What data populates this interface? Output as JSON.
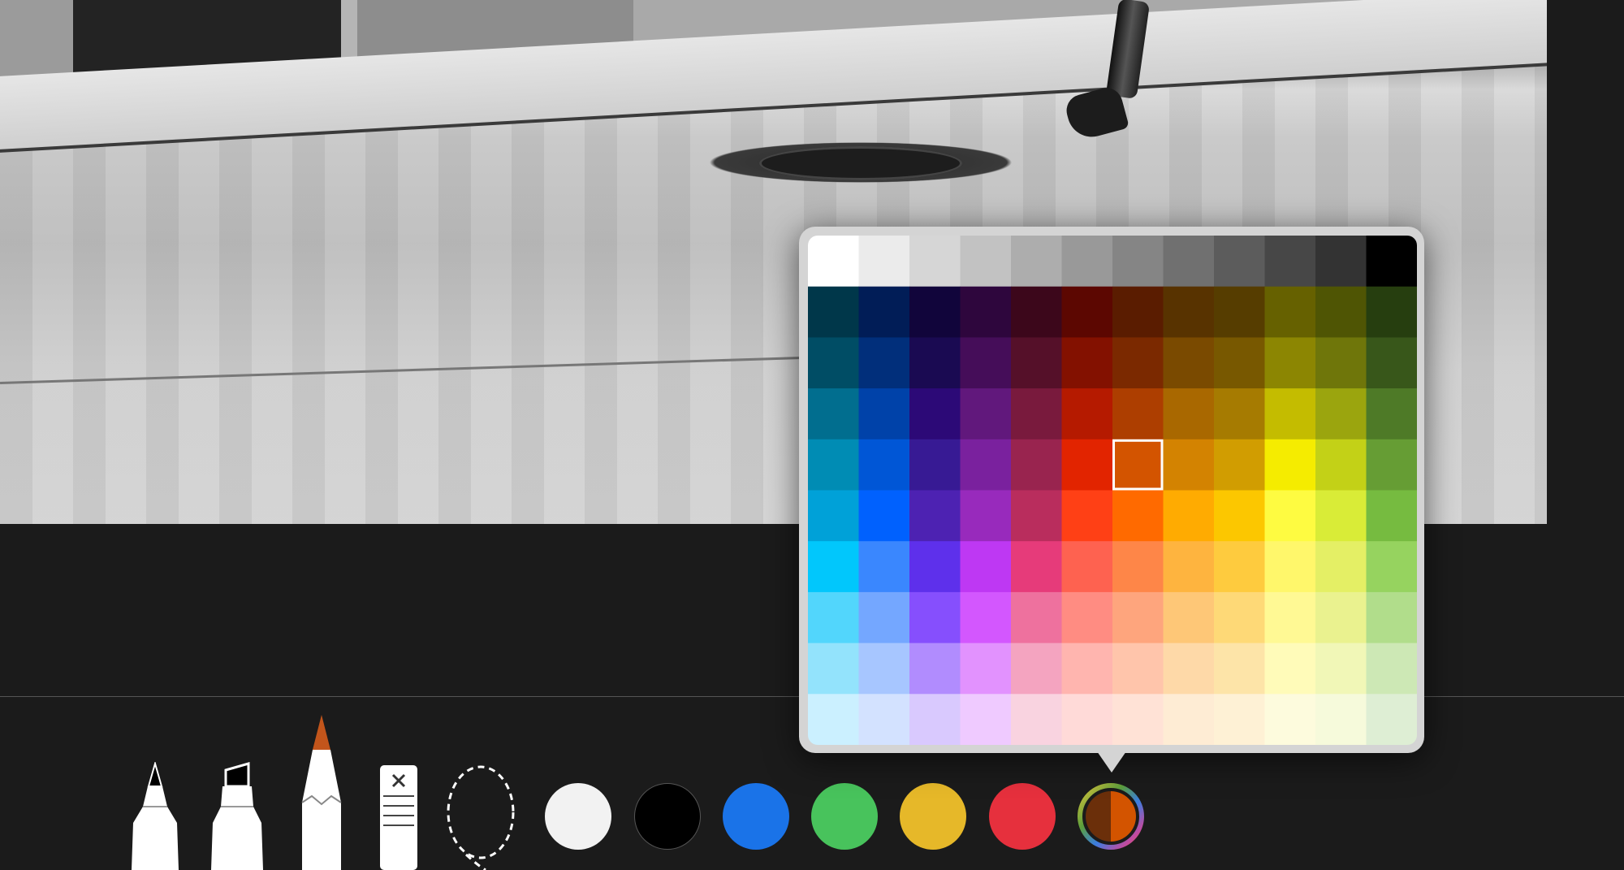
{
  "tools": [
    {
      "name": "pen",
      "icon": "pen-icon"
    },
    {
      "name": "marker",
      "icon": "marker-icon"
    },
    {
      "name": "pencil",
      "icon": "pencil-icon",
      "tip_color": "#c2551b"
    },
    {
      "name": "eraser",
      "icon": "eraser-icon"
    },
    {
      "name": "lasso",
      "icon": "lasso-icon"
    }
  ],
  "swatches": [
    {
      "name": "white",
      "color": "#f2f2f2"
    },
    {
      "name": "black",
      "color": "#000000"
    },
    {
      "name": "blue",
      "color": "#1a73e8"
    },
    {
      "name": "green",
      "color": "#48c35c"
    },
    {
      "name": "yellow",
      "color": "#e6b829"
    },
    {
      "name": "red",
      "color": "#e6303d"
    }
  ],
  "current_color": "#d35400",
  "selected_cell": {
    "row": 4,
    "col": 6
  },
  "palette": [
    [
      "#ffffff",
      "#ebebeb",
      "#d6d6d6",
      "#c2c2c2",
      "#adadad",
      "#999999",
      "#858585",
      "#707070",
      "#5c5c5c",
      "#474747",
      "#333333",
      "#000000"
    ],
    [
      "#00374a",
      "#011d57",
      "#11053b",
      "#2e063d",
      "#3c071b",
      "#5c0701",
      "#5a1c00",
      "#583300",
      "#563d00",
      "#666100",
      "#4f5504",
      "#263e0f"
    ],
    [
      "#004d65",
      "#012f7b",
      "#1a0a52",
      "#450d59",
      "#551029",
      "#831100",
      "#7b2900",
      "#7a4a00",
      "#785800",
      "#8c8602",
      "#6f760a",
      "#38571a"
    ],
    [
      "#016e8f",
      "#0042a9",
      "#2c0977",
      "#61187c",
      "#791a3d",
      "#b51a00",
      "#ad3e00",
      "#a96800",
      "#a67b01",
      "#c4bc00",
      "#9ba50e",
      "#4e7a27"
    ],
    [
      "#008cb4",
      "#0056d6",
      "#371a94",
      "#7a219e",
      "#99244f",
      "#e22400",
      "#d35400",
      "#d38301",
      "#d19d01",
      "#f5ec00",
      "#c3d117",
      "#669d34"
    ],
    [
      "#00a1d8",
      "#0061fe",
      "#4d22b2",
      "#982abc",
      "#b92d5d",
      "#ff4015",
      "#ff6a00",
      "#ffab01",
      "#fcc700",
      "#fefb41",
      "#d9ec37",
      "#76bb40"
    ],
    [
      "#01c7fc",
      "#3a87fe",
      "#5e30eb",
      "#be38f3",
      "#e63b7a",
      "#fe6250",
      "#fe8648",
      "#feb43f",
      "#fecb3e",
      "#fff76b",
      "#e4ef65",
      "#96d35f"
    ],
    [
      "#52d6fc",
      "#74a7ff",
      "#864ffd",
      "#d357fe",
      "#ee719e",
      "#ff8c82",
      "#fea57d",
      "#fec777",
      "#fed977",
      "#fff994",
      "#eaf28f",
      "#b1dd8b"
    ],
    [
      "#93e3fc",
      "#a7c6ff",
      "#b18cfe",
      "#e292fe",
      "#f4a4c0",
      "#ffb5af",
      "#ffc5ab",
      "#fed9a8",
      "#fde4a8",
      "#fffbb9",
      "#f1f7b7",
      "#cde8b5"
    ],
    [
      "#cbf0ff",
      "#d3e2ff",
      "#d9c9fe",
      "#efcaff",
      "#f9d3e0",
      "#ffdad8",
      "#ffe2d6",
      "#feecd4",
      "#fef1d5",
      "#fdfbdd",
      "#f6fadb",
      "#deeed4"
    ]
  ]
}
